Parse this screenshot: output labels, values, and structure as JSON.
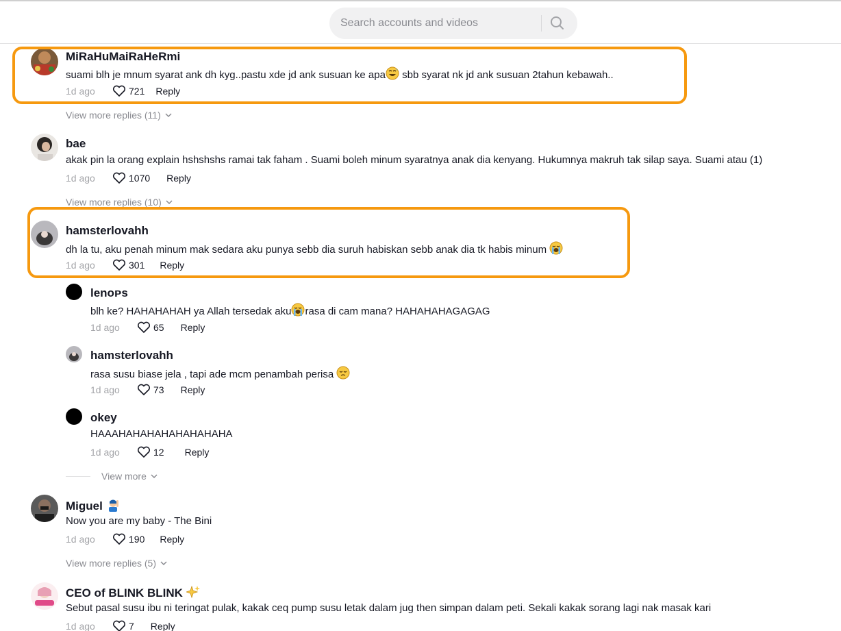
{
  "search": {
    "placeholder": "Search accounts and videos"
  },
  "comments": [
    {
      "username": "MiRaHuMaiRaHeRmi",
      "text_before": "suami blh je mnum syarat ank dh kyg..pastu xde jd ank susuan ke apa",
      "emoji": "grinning-sweat",
      "text_after": " sbb syarat nk jd ank susuan 2tahun kebawah..",
      "time": "1d ago",
      "likes": "721",
      "reply": "Reply",
      "view_more": "View more replies (11)"
    },
    {
      "username": "bae",
      "text": "akak pin la orang explain hshshshs ramai tak faham . Suami boleh minum syaratnya anak dia kenyang. Hukumnya makruh tak silap saya. Suami atau (1)",
      "time": "1d ago",
      "likes": "1070",
      "reply": "Reply",
      "view_more": "View more replies (10)"
    },
    {
      "username": "hamsterlovahh",
      "text": "dh la tu, aku penah minum mak sedara aku punya sebb dia suruh habiskan sebb anak dia tk habis minum ",
      "emoji": "loudly-crying",
      "time": "1d ago",
      "likes": "301",
      "reply": "Reply",
      "replies": [
        {
          "username": "lenoᴘs",
          "text_before": "blh ke? HAHAHAHAH ya Allah tersedak aku",
          "emoji": "loudly-crying",
          "text_after": "rasa di cam mana? HAHAHAHAGAGAG",
          "time": "1d ago",
          "likes": "65",
          "reply": "Reply"
        },
        {
          "username": "hamsterlovahh",
          "text": "rasa susu biase jela , tapi ade mcm penambah perisa ",
          "emoji": "pensive",
          "time": "1d ago",
          "likes": "73",
          "reply": "Reply"
        },
        {
          "username": "okey",
          "text": "HAAAHAHAHAHAHAHAHAHA",
          "time": "1d ago",
          "likes": "12",
          "reply": "Reply"
        }
      ],
      "view_more": "View more"
    },
    {
      "username": "Miguel",
      "emoji": "person-raising-hand",
      "text": "Now you are my baby - The Bini",
      "time": "1d ago",
      "likes": "190",
      "reply": "Reply",
      "view_more": "View more replies (5)"
    },
    {
      "username": "CEO of BLINK BLINK",
      "emoji": "sparkles",
      "text": "Sebut pasal susu ibu ni teringat pulak, kakak ceq pump susu letak dalam jug then simpan dalam peti. Sekali kakak sorang lagi nak masak kari",
      "time": "1d ago",
      "likes": "7",
      "reply": "Reply"
    }
  ],
  "colors": {
    "highlight": "#f6990f",
    "muted": "#8a8b91",
    "text": "#161823"
  }
}
